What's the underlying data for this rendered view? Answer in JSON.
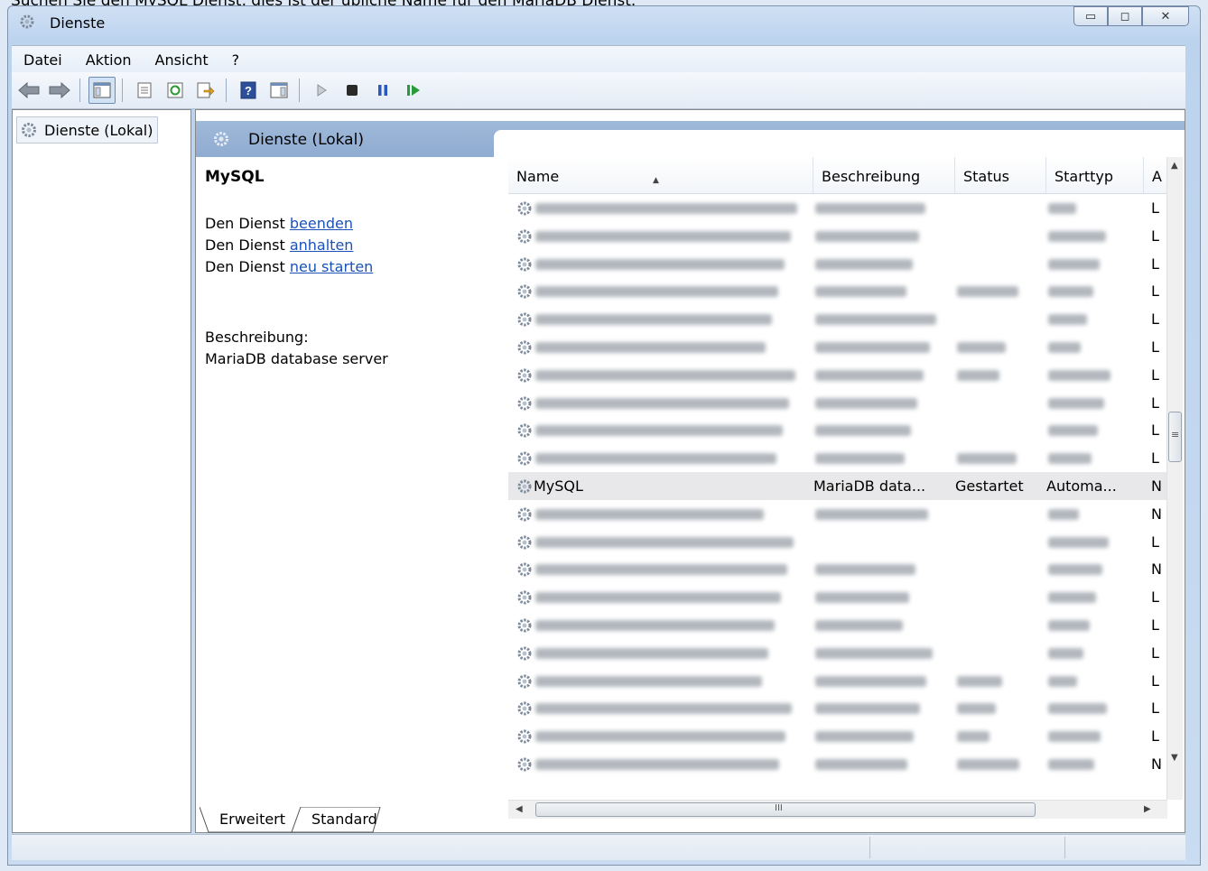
{
  "caption": "Suchen Sie den MySQL Dienst, dies ist der übliche Name für den MariaDB Dienst.",
  "window": {
    "title": "Dienste"
  },
  "menu": [
    "Datei",
    "Aktion",
    "Ansicht",
    "?"
  ],
  "toolbar": {
    "icons": [
      "back-icon",
      "forward-icon",
      "show-hide-console-tree-icon",
      "properties-icon",
      "refresh-icon",
      "export-list-icon",
      "help-icon",
      "show-action-pane-icon",
      "start-service-icon",
      "stop-service-icon",
      "pause-service-icon",
      "resume-service-icon"
    ]
  },
  "tree": {
    "root": "Dienste (Lokal)"
  },
  "pane": {
    "title": "Dienste (Lokal)"
  },
  "details": {
    "service_name": "MySQL",
    "prefix": "Den Dienst",
    "link_stop": "beenden",
    "link_pause": "anhalten",
    "link_restart": "neu starten",
    "desc_label": "Beschreibung:",
    "desc_text": "MariaDB database server"
  },
  "columns": [
    "Name",
    "Beschreibung",
    "Status",
    "Starttyp",
    "A"
  ],
  "rows": [
    {
      "name": "",
      "desc": "",
      "status": "",
      "start": "",
      "logon": "L",
      "blur": [
        true,
        true,
        false,
        true
      ]
    },
    {
      "name": "",
      "desc": "",
      "status": "",
      "start": "",
      "logon": "L",
      "blur": [
        true,
        true,
        false,
        true
      ]
    },
    {
      "name": "",
      "desc": "",
      "status": "",
      "start": "",
      "logon": "L",
      "blur": [
        true,
        true,
        false,
        true
      ]
    },
    {
      "name": "",
      "desc": "",
      "status": "",
      "start": "",
      "logon": "L",
      "blur": [
        true,
        true,
        true,
        true
      ]
    },
    {
      "name": "",
      "desc": "",
      "status": "",
      "start": "",
      "logon": "L",
      "blur": [
        true,
        true,
        false,
        true
      ]
    },
    {
      "name": "",
      "desc": "",
      "status": "",
      "start": "",
      "logon": "L",
      "blur": [
        true,
        true,
        true,
        true
      ]
    },
    {
      "name": "",
      "desc": "",
      "status": "",
      "start": "",
      "logon": "L",
      "blur": [
        true,
        true,
        true,
        true
      ]
    },
    {
      "name": "",
      "desc": "",
      "status": "",
      "start": "",
      "logon": "L",
      "blur": [
        true,
        true,
        false,
        true
      ]
    },
    {
      "name": "",
      "desc": "",
      "status": "",
      "start": "",
      "logon": "L",
      "blur": [
        true,
        true,
        false,
        true
      ]
    },
    {
      "name": "",
      "desc": "",
      "status": "",
      "start": "",
      "logon": "L",
      "blur": [
        true,
        true,
        true,
        true
      ]
    },
    {
      "name": "MySQL",
      "desc": "MariaDB data...",
      "status": "Gestartet",
      "start": "Automa...",
      "logon": "N",
      "blur": [
        false,
        false,
        false,
        false
      ],
      "selected": true
    },
    {
      "name": "",
      "desc": "",
      "status": "",
      "start": "",
      "logon": "N",
      "blur": [
        true,
        true,
        false,
        true
      ]
    },
    {
      "name": "",
      "desc": "",
      "status": "",
      "start": "",
      "logon": "L",
      "blur": [
        true,
        false,
        false,
        true
      ]
    },
    {
      "name": "",
      "desc": "",
      "status": "",
      "start": "",
      "logon": "N",
      "blur": [
        true,
        true,
        false,
        true
      ]
    },
    {
      "name": "",
      "desc": "",
      "status": "",
      "start": "",
      "logon": "L",
      "blur": [
        true,
        true,
        false,
        true
      ]
    },
    {
      "name": "",
      "desc": "",
      "status": "",
      "start": "",
      "logon": "L",
      "blur": [
        true,
        true,
        false,
        true
      ]
    },
    {
      "name": "",
      "desc": "",
      "status": "",
      "start": "",
      "logon": "L",
      "blur": [
        true,
        true,
        false,
        true
      ]
    },
    {
      "name": "",
      "desc": "",
      "status": "",
      "start": "",
      "logon": "L",
      "blur": [
        true,
        true,
        true,
        true
      ]
    },
    {
      "name": "",
      "desc": "",
      "status": "",
      "start": "",
      "logon": "L",
      "blur": [
        true,
        true,
        true,
        true
      ]
    },
    {
      "name": "",
      "desc": "",
      "status": "",
      "start": "",
      "logon": "L",
      "blur": [
        true,
        true,
        true,
        true
      ]
    },
    {
      "name": "",
      "desc": "",
      "status": "",
      "start": "",
      "logon": "N",
      "blur": [
        true,
        true,
        true,
        true
      ]
    }
  ],
  "tabs": [
    "Erweitert",
    "Standard"
  ],
  "scroll": {
    "h_glyph": "III",
    "v_glyph": "≡"
  }
}
